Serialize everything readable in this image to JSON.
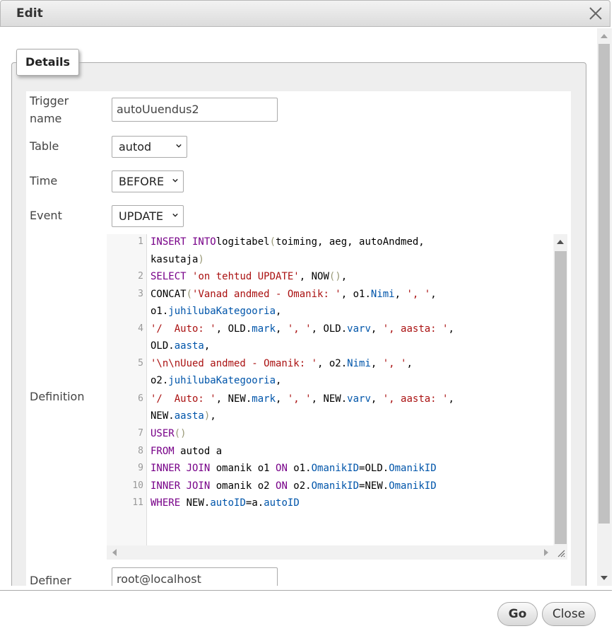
{
  "dialog": {
    "title": "Edit"
  },
  "fieldset": {
    "legend": "Details"
  },
  "fields": {
    "trigger_name": {
      "label_line1": "Trigger",
      "label_line2": "name",
      "value": "autoUuendus2"
    },
    "table": {
      "label": "Table",
      "value": "autod"
    },
    "time": {
      "label": "Time",
      "value": "BEFORE"
    },
    "event": {
      "label": "Event",
      "value": "UPDATE"
    },
    "definition": {
      "label": "Definition"
    },
    "definer": {
      "label": "Definer",
      "value": "root@localhost"
    }
  },
  "editor": {
    "line_numbers": [
      "1",
      "2",
      "3",
      "4",
      "5",
      "6",
      "7",
      "8",
      "9",
      "10",
      "11"
    ]
  },
  "buttons": {
    "go": "Go",
    "close": "Close"
  },
  "icons": {
    "dialog_close": "close-x-icon",
    "select_arrow": "chevron-down-icon",
    "resize": "resize-grip-icon"
  },
  "colors": {
    "keyword": "#770088",
    "string": "#aa1111",
    "property": "#0055aa"
  }
}
